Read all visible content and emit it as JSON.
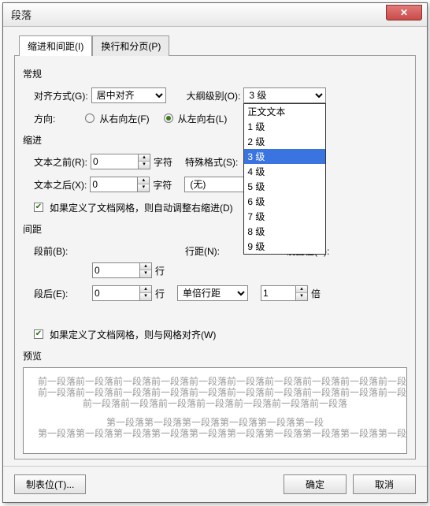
{
  "window": {
    "title": "段落"
  },
  "tabs": {
    "active": "缩进和间距(I)",
    "inactive": "换行和分页(P)"
  },
  "sections": {
    "general": "常规",
    "indent": "缩进",
    "spacing": "间距",
    "preview": "预览"
  },
  "general": {
    "align_label": "对齐方式(G):",
    "align_value": "居中对齐",
    "outline_label": "大纲级别(O):",
    "outline_value": "3 级",
    "direction_label": "方向:",
    "rtl_label": "从右向左(F)",
    "ltr_label": "从左向右(L)",
    "rtl_checked": false,
    "ltr_checked": true
  },
  "indent": {
    "before_label": "文本之前(R):",
    "before_value": "0",
    "after_label": "文本之后(X):",
    "after_value": "0",
    "unit": "字符",
    "special_label": "特殊格式(S):",
    "special_value": "(无)",
    "auto_adjust": "如果定义了文档网格，则自动调整右缩进(D)",
    "auto_adjust_checked": true
  },
  "spacing": {
    "before_label": "段前(B):",
    "before_value": "0",
    "after_label": "段后(E):",
    "after_value": "0",
    "unit": "行",
    "line_spacing_label": "行距(N):",
    "line_spacing_value": "单倍行距",
    "set_value_label": "设置值(A):",
    "set_value": "1",
    "set_unit": "倍",
    "snap_grid": "如果定义了文档网格，则与网格对齐(W)",
    "snap_grid_checked": true
  },
  "outline_options": {
    "items": [
      "正文文本",
      "1 级",
      "2 级",
      "3 级",
      "4 级",
      "5 级",
      "6 级",
      "7 级",
      "8 级",
      "9 级"
    ],
    "selected": "3 级"
  },
  "preview": {
    "line_a": "前一段落前一段落前一段落前一段落前一段落前一段落前一段落前一段落前一段落前一段落",
    "line_b": "前一段落前一段落前一段落前一段落前一段落前一段落前一段落前一段落前一段落前一段落",
    "line_c": "前一段落前一段落前一段落前一段落前一段落前一段落前一段落",
    "line_d": "第一段落第一段落第一段落第一段落第一段落第一段",
    "line_e": "第一段落第一段落第一段落第一段落第一段落第一段落第一段落第一段落第一段落第一段落第一段落第"
  },
  "footer": {
    "tabs_btn": "制表位(T)...",
    "ok": "确定",
    "cancel": "取消"
  }
}
